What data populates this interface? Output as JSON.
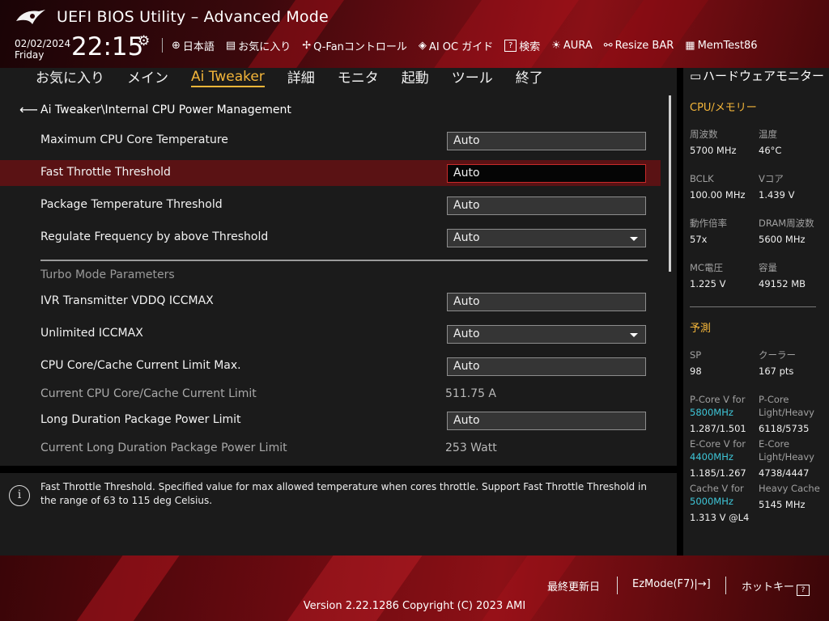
{
  "header": {
    "title": "UEFI BIOS Utility – Advanced Mode",
    "date": "02/02/2024",
    "day": "Friday",
    "time": "22:15",
    "tools": [
      {
        "icon": "globe-icon",
        "label": "日本語"
      },
      {
        "icon": "bookmark-icon",
        "label": "お気に入り"
      },
      {
        "icon": "fan-icon",
        "label": "Q-Fanコントロール"
      },
      {
        "icon": "ai-oc-icon",
        "label": "AI OC ガイド"
      },
      {
        "icon": "help-search-icon",
        "label": "検索"
      },
      {
        "icon": "aura-icon",
        "label": "AURA"
      },
      {
        "icon": "resize-bar-icon",
        "label": "Resize BAR"
      },
      {
        "icon": "memtest-icon",
        "label": "MemTest86"
      }
    ]
  },
  "nav": {
    "tabs": [
      "お気に入り",
      "メイン",
      "Ai Tweaker",
      "詳細",
      "モニタ",
      "起動",
      "ツール",
      "終了"
    ],
    "active": "Ai Tweaker"
  },
  "breadcrumb": "Ai Tweaker\\Internal CPU Power Management",
  "settings": [
    {
      "label": "Maximum CPU Core Temperature",
      "value": "Auto"
    },
    {
      "label": "Fast Throttle Threshold",
      "value": "Auto"
    },
    {
      "label": "Package Temperature Threshold",
      "value": "Auto"
    },
    {
      "label": "Regulate Frequency by above Threshold",
      "value": "Auto"
    }
  ],
  "section_title": "Turbo Mode Parameters",
  "turbo_settings": [
    {
      "label": "IVR Transmitter VDDQ ICCMAX",
      "value": "Auto"
    },
    {
      "label": "Unlimited ICCMAX",
      "value": "Auto"
    },
    {
      "label": "CPU Core/Cache Current Limit Max.",
      "value": "Auto"
    },
    {
      "label": "Current CPU Core/Cache Current Limit",
      "value": "511.75 A"
    },
    {
      "label": "Long Duration Package Power Limit",
      "value": "Auto"
    },
    {
      "label": "Current Long Duration Package Power Limit",
      "value": "253 Watt"
    }
  ],
  "help_text": "Fast Throttle Threshold. Specified value for max allowed temperature when cores throttle. Support Fast Throttle Threshold in the range of 63 to 115 deg Celsius.",
  "hw_monitor": {
    "title": "ハードウェアモニター",
    "cpu_section": "CPU/メモリー",
    "items": [
      {
        "label": "周波数",
        "value": "5700 MHz"
      },
      {
        "label": "温度",
        "value": "46°C"
      },
      {
        "label": "BCLK",
        "value": "100.00 MHz"
      },
      {
        "label": "Vコア",
        "value": "1.439 V"
      },
      {
        "label": "動作倍率",
        "value": "57x"
      },
      {
        "label": "DRAM周波数",
        "value": "5600 MHz"
      },
      {
        "label": "MC電圧",
        "value": "1.225 V"
      },
      {
        "label": "容量",
        "value": "49152 MB"
      }
    ],
    "prediction_section": "予測",
    "sp_label": "SP",
    "sp_value": "98",
    "cooler_label": "クーラー",
    "cooler_value": "167 pts",
    "pcore_v_label": "P-Core V for",
    "pcore_v_freq": "5800MHz",
    "pcore_v_value": "1.287/1.501",
    "pcore_lh_label1": "P-Core",
    "pcore_lh_label2": "Light/Heavy",
    "pcore_lh_value": "6118/5735",
    "ecore_v_label": "E-Core V for",
    "ecore_v_freq": "4400MHz",
    "ecore_v_value": "1.185/1.267",
    "ecore_lh_label1": "E-Core",
    "ecore_lh_label2": "Light/Heavy",
    "ecore_lh_value": "4738/4447",
    "cache_v_label": "Cache V for",
    "cache_v_freq": "5000MHz",
    "cache_v_value": "1.313 V @L4",
    "heavy_cache_label": "Heavy Cache",
    "heavy_cache_value": "5145 MHz"
  },
  "footer": {
    "last_modified": "最終更新日",
    "ezmode": "EzMode(F7)|",
    "hotkey": "ホットキー",
    "hotkey_key": "?",
    "version": "Version 2.22.1286 Copyright (C) 2023 AMI"
  },
  "colors": {
    "accent": "#f4b63a",
    "selected_row": "#5a1214",
    "frequency": "#3ec6d8"
  }
}
